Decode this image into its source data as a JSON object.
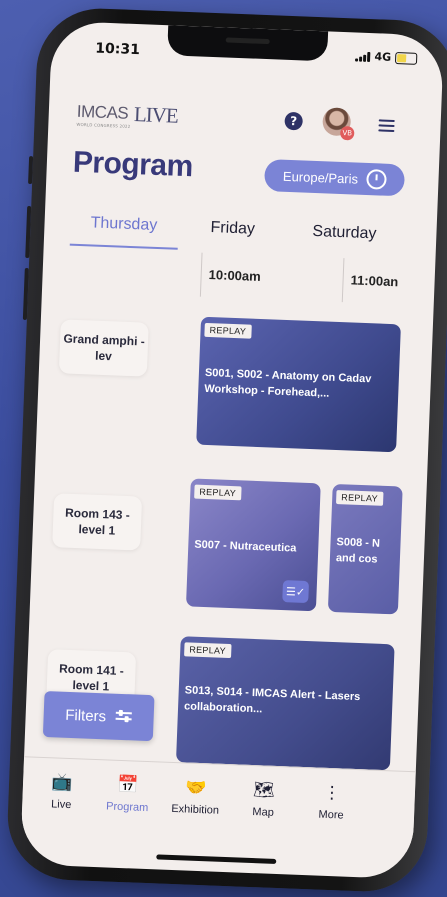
{
  "status": {
    "time": "10:31",
    "network": "4G"
  },
  "header": {
    "logo_text": "IMCAS",
    "logo_sub": "WORLD CONGRESS 2022",
    "logo_live": "LIVE",
    "badge": "VB"
  },
  "page": {
    "title": "Program",
    "timezone": "Europe/Paris"
  },
  "days": [
    "Thursday",
    "Friday",
    "Saturday"
  ],
  "times": [
    "10:00am",
    "11:00an"
  ],
  "rooms": [
    "Grand amphi - lev",
    "Room 143 - level 1",
    "Room 141 - level 1"
  ],
  "sessions": [
    {
      "badge": "REPLAY",
      "title": "S001, S002 - Anatomy on Cadav Workshop - Forehead,..."
    },
    {
      "badge": "REPLAY",
      "title": "S007 - Nutraceutica"
    },
    {
      "badge": "REPLAY",
      "title": "S008 - N and cos"
    },
    {
      "badge": "REPLAY",
      "title": "S013, S014 - IMCAS Alert - Lasers collaboration..."
    }
  ],
  "filters_label": "Filters",
  "tabbar": [
    "Live",
    "Program",
    "Exhibition",
    "Map",
    "More"
  ],
  "colors": {
    "accent": "#7b84d6",
    "title": "#38397a",
    "background": "#f3eeec"
  }
}
